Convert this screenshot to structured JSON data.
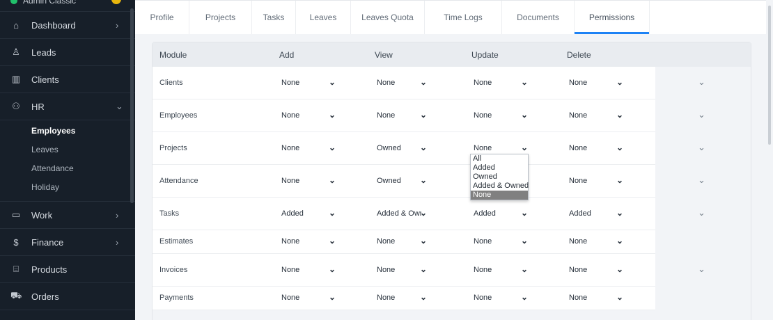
{
  "sidebar": {
    "user_name": "Admin Classic",
    "items_top": [
      {
        "label": "Dashboard",
        "icon": "home-icon",
        "glyph": "⌂",
        "chevron": "›"
      },
      {
        "label": "Leads",
        "icon": "person-icon",
        "glyph": "♙",
        "chevron": ""
      },
      {
        "label": "Clients",
        "icon": "chart-icon",
        "glyph": "▥",
        "chevron": ""
      },
      {
        "label": "HR",
        "icon": "people-icon",
        "glyph": "⚇",
        "chevron": "⌄"
      }
    ],
    "hr_sub": [
      "Employees",
      "Leaves",
      "Attendance",
      "Holiday"
    ],
    "items_bottom": [
      {
        "label": "Work",
        "icon": "briefcase-icon",
        "glyph": "▭",
        "chevron": "›"
      },
      {
        "label": "Finance",
        "icon": "dollar-icon",
        "glyph": "$",
        "chevron": "›"
      },
      {
        "label": "Products",
        "icon": "basket-icon",
        "glyph": "⌸",
        "chevron": ""
      },
      {
        "label": "Orders",
        "icon": "cart-icon",
        "glyph": "⛟",
        "chevron": ""
      }
    ]
  },
  "tabs": [
    {
      "label": "Profile"
    },
    {
      "label": "Projects"
    },
    {
      "label": "Tasks"
    },
    {
      "label": "Leaves"
    },
    {
      "label": "Leaves Quota"
    },
    {
      "label": "Time Logs"
    },
    {
      "label": "Documents"
    },
    {
      "label": "Permissions"
    }
  ],
  "table": {
    "headers": [
      "Module",
      "Add",
      "View",
      "Update",
      "Delete"
    ],
    "rows": [
      {
        "module": "Clients",
        "add": "None",
        "view": "None",
        "update": "None",
        "delete": "None",
        "expandable": true
      },
      {
        "module": "Employees",
        "add": "None",
        "view": "None",
        "update": "None",
        "delete": "None",
        "expandable": true
      },
      {
        "module": "Projects",
        "add": "None",
        "view": "Owned",
        "update": "None",
        "delete": "None",
        "expandable": true
      },
      {
        "module": "Attendance",
        "add": "None",
        "view": "Owned",
        "update": "",
        "delete": "None",
        "expandable": true
      },
      {
        "module": "Tasks",
        "add": "Added",
        "view": "Added & Owned",
        "update": "Added",
        "delete": "Added",
        "expandable": true
      },
      {
        "module": "Estimates",
        "add": "None",
        "view": "None",
        "update": "None",
        "delete": "None",
        "expandable": false
      },
      {
        "module": "Invoices",
        "add": "None",
        "view": "None",
        "update": "None",
        "delete": "None",
        "expandable": true
      },
      {
        "module": "Payments",
        "add": "None",
        "view": "None",
        "update": "None",
        "delete": "None",
        "expandable": false
      }
    ]
  },
  "dropdown": {
    "options": [
      "All",
      "Added",
      "Owned",
      "Added & Owned",
      "None"
    ],
    "highlighted": "None"
  },
  "colors": {
    "accent": "#1d82f5",
    "sidebar_bg": "#171f29",
    "status_online": "#21c06b"
  }
}
